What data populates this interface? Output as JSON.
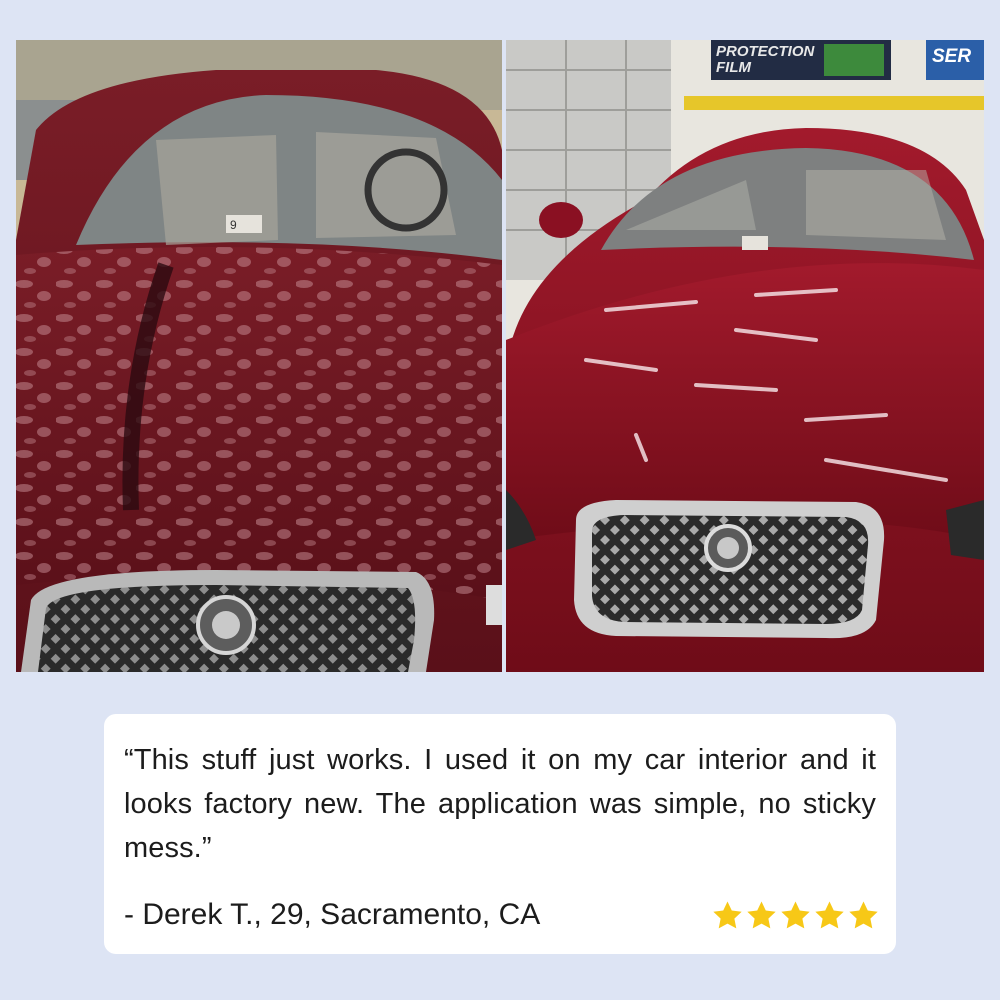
{
  "photos": {
    "before": {
      "alt": "before",
      "sign_text": "9"
    },
    "after": {
      "sign_protection": "PROTECTION",
      "sign_film": "FILM",
      "sign_service": "SER"
    }
  },
  "review": {
    "quote": "“This stuff just works. I used it on my car interior and it looks factory new. The application was simple, no sticky mess.”",
    "author": "- Derek T., 29, Sacramento, CA",
    "rating": 5,
    "rating_max": 5,
    "star_color": "#f7c817"
  },
  "colors": {
    "background": "#dde4f4",
    "card": "#ffffff",
    "car_red": "#8c1424"
  }
}
